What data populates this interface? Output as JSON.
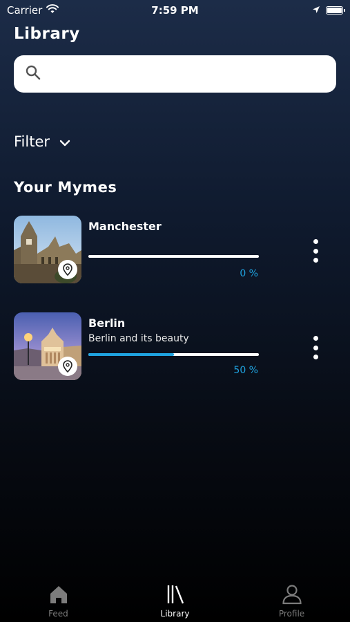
{
  "status_bar": {
    "carrier": "Carrier",
    "time": "7:59 PM"
  },
  "page": {
    "title": "Library"
  },
  "search": {
    "placeholder": ""
  },
  "filter": {
    "label": "Filter"
  },
  "section": {
    "title": "Your Mymes"
  },
  "mymes": [
    {
      "title": "Manchester",
      "subtitle": "",
      "progress_text": "0 %",
      "progress": 0
    },
    {
      "title": "Berlin",
      "subtitle": "Berlin and its beauty",
      "progress_text": "50 %",
      "progress": 0.5
    }
  ],
  "tabs": [
    {
      "label": "Feed",
      "icon": "home-icon",
      "active": false
    },
    {
      "label": "Library",
      "icon": "library-icon",
      "active": true
    },
    {
      "label": "Profile",
      "icon": "person-icon",
      "active": false
    }
  ],
  "colors": {
    "accent": "#1fa3e0",
    "inactive_tab": "#7c7c7c"
  }
}
